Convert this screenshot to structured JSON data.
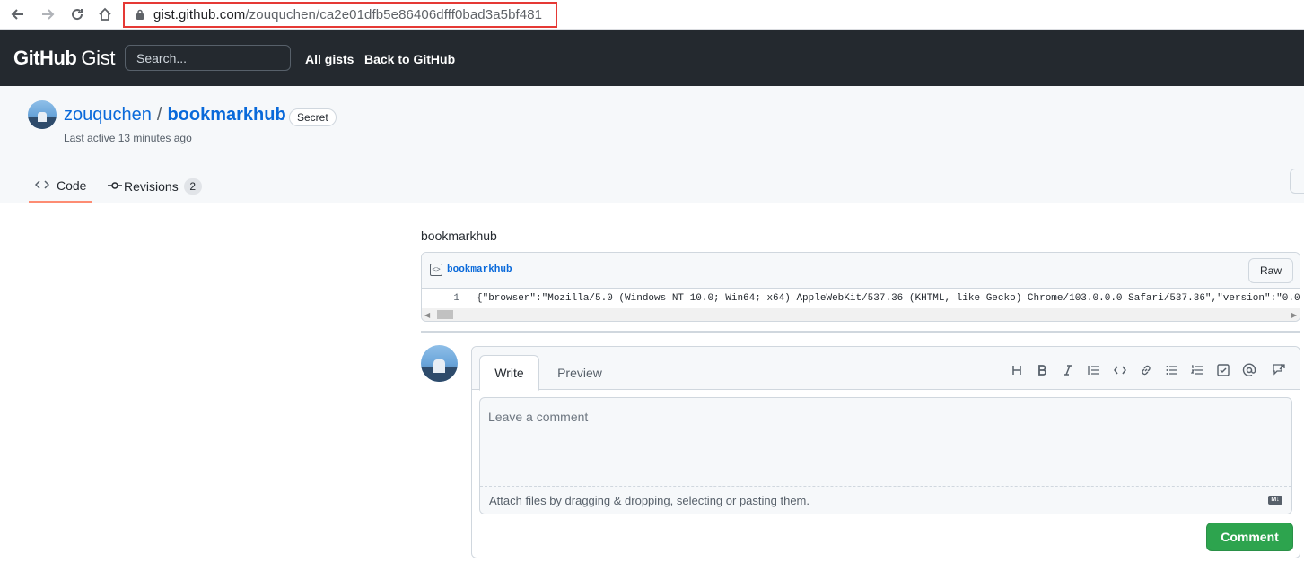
{
  "browser": {
    "url_host": "gist.github.com",
    "url_path": "/zouquchen/ca2e01dfb5e86406dfff0bad3a5bf481"
  },
  "header": {
    "logo_bold": "GitHub",
    "logo_light": "Gist",
    "search_placeholder": "Search...",
    "links": [
      "All gists",
      "Back to GitHub"
    ]
  },
  "gist": {
    "owner": "zouquchen",
    "separator": "/",
    "name": "bookmarkhub",
    "visibility_badge": "Secret",
    "last_active": "Last active 13 minutes ago"
  },
  "tabs": [
    {
      "label": "Code",
      "icon": "code-icon",
      "active": true
    },
    {
      "label": "Revisions",
      "icon": "commit-icon",
      "count": "2"
    }
  ],
  "content": {
    "description": "bookmarkhub",
    "file": {
      "name": "bookmarkhub",
      "raw_label": "Raw",
      "lines": [
        {
          "number": "1",
          "code": "{\"browser\":\"Mozilla/5.0 (Windows NT 10.0; Win64; x64) AppleWebKit/537.36 (KHTML, like Gecko) Chrome/103.0.0.0 Safari/537.36\",\"version\":\"0.0"
        }
      ]
    }
  },
  "comment": {
    "tab_write": "Write",
    "tab_preview": "Preview",
    "toolbar_icons": [
      "heading-icon",
      "bold-icon",
      "italic-icon",
      "quote-icon",
      "code-icon",
      "link-icon",
      "unordered-list-icon",
      "ordered-list-icon",
      "task-list-icon",
      "mention-icon",
      "reference-icon"
    ],
    "placeholder": "Leave a comment",
    "attach_text": "Attach files by dragging & dropping, selecting or pasting them.",
    "markdown_badge": "M↓",
    "submit_label": "Comment"
  },
  "colors": {
    "header_bg": "#24292f",
    "link_blue": "#0969da",
    "active_tab_underline": "#fd8c73",
    "comment_button": "#2da44e",
    "url_highlight": "#e53935"
  }
}
